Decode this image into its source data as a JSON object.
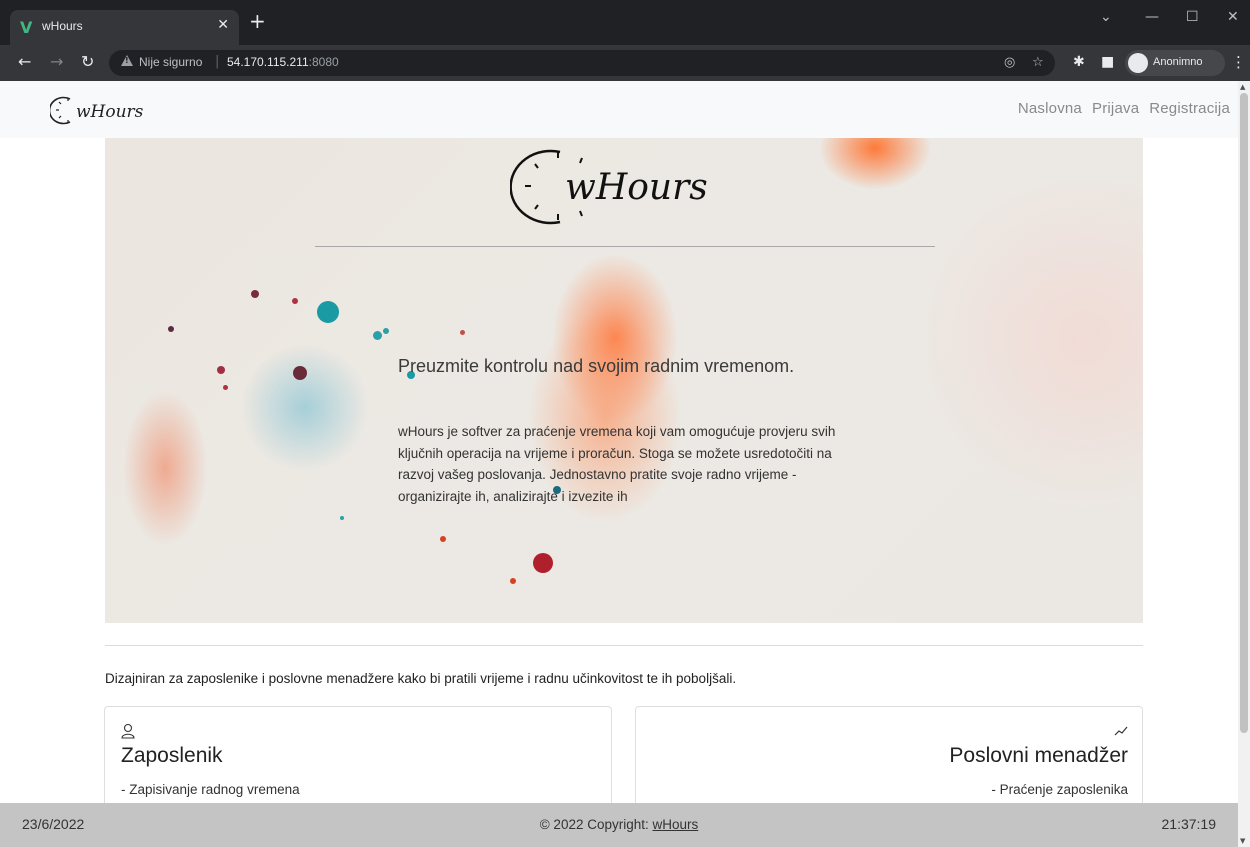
{
  "browser": {
    "tab_title": "wHours",
    "tab_favicon": "V",
    "url_warning": "Nije sigurno",
    "url_host": "54.170.115.211",
    "url_port": ":8080",
    "profile_label": "Anonimno",
    "icons": [
      "back-icon",
      "forward-icon",
      "reload-icon",
      "warning-icon",
      "eye-off-icon",
      "star-icon",
      "extensions-icon",
      "sidepanel-icon",
      "incognito-icon",
      "menu-icon"
    ]
  },
  "navbar": {
    "brand": "wHours",
    "links": [
      "Naslovna",
      "Prijava",
      "Registracija"
    ]
  },
  "hero": {
    "logo_text": "wHours",
    "title": "Preuzmite kontrolu nad svojim radnim vremenom.",
    "text": "wHours je softver za praćenje vremena koji vam omogućuje provjeru svih ključnih operacija na vrijeme i proračun. Stoga se možete usredotočiti na razvoj vašeg poslovanja. Jednostavno pratite svoje radno vrijeme - organizirajte ih, analizirajte i izvezite ih"
  },
  "tagline": "Dizajniran za zaposlenike i poslovne menadžere kako bi pratili vrijeme i radnu učinkovitost te ih poboljšali.",
  "cards": [
    {
      "icon": "user-icon",
      "title": "Zaposlenik",
      "desc": "- Zapisivanje radnog vremena"
    },
    {
      "icon": "trend-line-icon",
      "title": "Poslovni menadžer",
      "desc": "- Praćenje zaposlenika"
    }
  ],
  "footer": {
    "date": "23/6/2022",
    "copyright": "© 2022 Copyright: ",
    "copyright_link": "wHours",
    "time": "21:37:19"
  }
}
